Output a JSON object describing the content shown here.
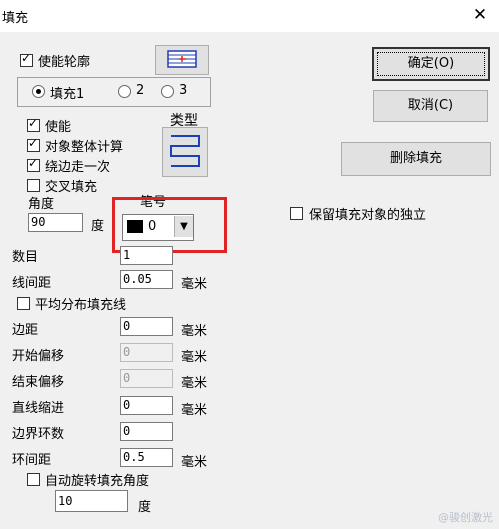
{
  "window": {
    "title": "填充",
    "close_label": "✕"
  },
  "contour": {
    "enable_label": "使能轮廓",
    "enabled": true
  },
  "fill_tabs": [
    {
      "label": "填充1",
      "selected": true
    },
    {
      "label": "2",
      "selected": false
    },
    {
      "label": "3",
      "selected": false
    }
  ],
  "options": {
    "enable_label": "使能",
    "enable_checked": true,
    "whole_label": "对象整体计算",
    "whole_checked": true,
    "edge_once_label": "绕边走一次",
    "edge_once_checked": true,
    "cross_label": "交叉填充",
    "cross_checked": false
  },
  "type_label": "类型",
  "angle": {
    "label": "角度",
    "value": "90",
    "unit": "度"
  },
  "pen": {
    "label": "笔号",
    "value": "0",
    "color": "#000000"
  },
  "count": {
    "label": "数目",
    "value": "1"
  },
  "line_spacing": {
    "label": "线间距",
    "value": "0.05",
    "unit": "毫米"
  },
  "even_distribution": {
    "label": "平均分布填充线",
    "checked": false
  },
  "margin": {
    "label": "边距",
    "value": "0",
    "unit": "毫米"
  },
  "start_offset": {
    "label": "开始偏移",
    "value": "0",
    "unit": "毫米"
  },
  "end_offset": {
    "label": "结束偏移",
    "value": "0",
    "unit": "毫米"
  },
  "line_indent": {
    "label": "直线缩进",
    "value": "0",
    "unit": "毫米"
  },
  "boundary_rings": {
    "label": "边界环数",
    "value": "0"
  },
  "ring_spacing": {
    "label": "环间距",
    "value": "0.5",
    "unit": "毫米"
  },
  "auto_rotate": {
    "label": "自动旋转填充角度",
    "checked": false,
    "value": "10",
    "unit": "度"
  },
  "buttons": {
    "ok": "确定(O)",
    "cancel": "取消(C)",
    "delete": "删除填充"
  },
  "keep_independent": {
    "label": "保留填充对象的独立",
    "checked": false
  },
  "watermark": "@骏创激光"
}
